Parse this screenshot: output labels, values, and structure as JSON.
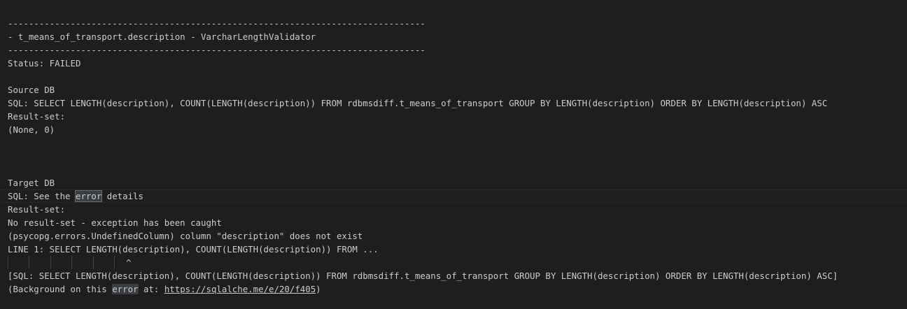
{
  "terminal": {
    "lines": {
      "sep1": "--------------------------------------------------------------------------------",
      "header": "- t_means_of_transport.description - VarcharLengthValidator",
      "sep2": "--------------------------------------------------------------------------------",
      "status": "Status: FAILED",
      "source_title": "Source DB",
      "source_sql": "SQL: SELECT LENGTH(description), COUNT(LENGTH(description)) FROM rdbmsdiff.t_means_of_transport GROUP BY LENGTH(description) ORDER BY LENGTH(description) ASC",
      "source_result_label": "Result-set:",
      "source_result": "(None, 0)",
      "target_title": "Target DB",
      "target_sql_prefix": "SQL: See the ",
      "target_sql_error_word": "error",
      "target_sql_suffix": " details",
      "target_result_label": "Result-set:",
      "no_result": "No result-set - exception has been caught",
      "psycopg_error": "(psycopg.errors.UndefinedColumn) column \"description\" does not exist",
      "line1": "LINE 1: SELECT LENGTH(description), COUNT(LENGTH(description)) FROM ...",
      "caret": "^",
      "sql_bracket": "[SQL: SELECT LENGTH(description), COUNT(LENGTH(description)) FROM rdbmsdiff.t_means_of_transport GROUP BY LENGTH(description) ORDER BY LENGTH(description) ASC]",
      "background_prefix": "(Background on this ",
      "background_error_word": "error",
      "background_middle": " at: ",
      "background_link": "https://sqlalche.me/e/20/f405",
      "background_suffix": ")"
    }
  }
}
